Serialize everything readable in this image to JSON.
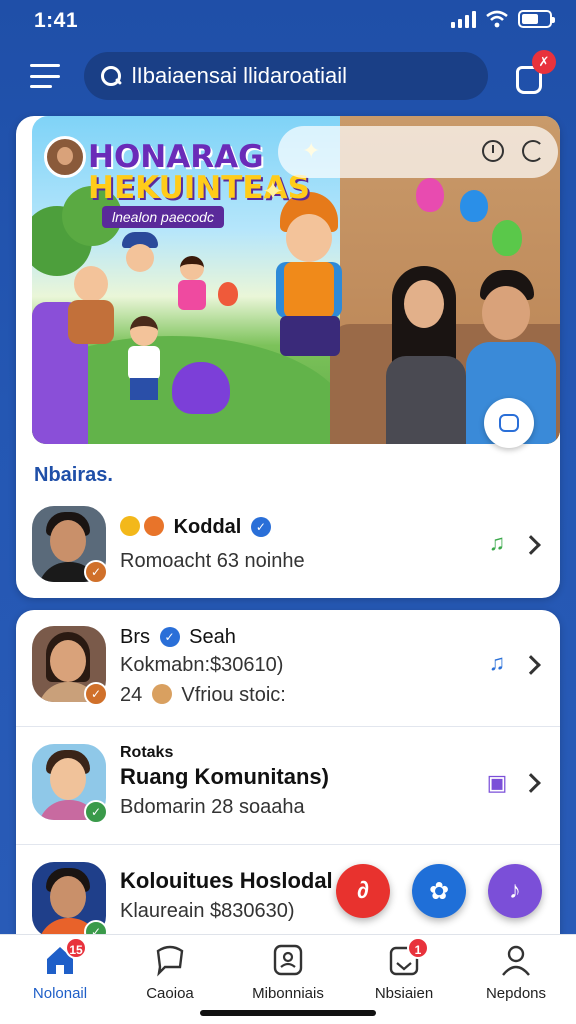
{
  "status_bar": {
    "time": "1:41"
  },
  "search": {
    "placeholder": "lIbaiaensai llidaroatiail"
  },
  "header": {
    "notification_badge": "✗"
  },
  "banner": {
    "title_line1": "HONARAG",
    "title_line2": "HEKUINTEAS",
    "subtitle": "lnealon paecodc"
  },
  "section": {
    "title": "Nbairas."
  },
  "items": [
    {
      "name": "Koddal",
      "subtitle": "Romoacht 63 noinhe",
      "badge_color": "#d0702a",
      "action_icon": "music-note-icon",
      "verified": true
    },
    {
      "name_prefix": "Brs",
      "name": "Seah",
      "subtitle": "Kokmabn:$30610)",
      "extra": "24",
      "extra_text": "Vfriou stoic:",
      "badge_color": "#d0702a",
      "action_icon": "music-heart-icon",
      "verified": true
    },
    {
      "label": "Rotaks",
      "name": "Ruang Komunitans)",
      "subtitle": "Bdomarin 28 soaaha",
      "badge_color": "#3a9a4a",
      "action_icon": "photo-icon"
    },
    {
      "name": "Kolouitues Hoslodal",
      "subtitle": "Klaureain $830630)",
      "badge_color": "#3a9a4a"
    }
  ],
  "fabs": [
    {
      "name": "link-fab",
      "color": "#e8322e"
    },
    {
      "name": "share-fab",
      "color": "#1f6fd8"
    },
    {
      "name": "audio-fab",
      "color": "#7b4fd8"
    }
  ],
  "bottom_nav": [
    {
      "label": "Nolonail",
      "icon": "home-icon",
      "badge": "15",
      "active": true
    },
    {
      "label": "Caoioa",
      "icon": "chat-icon"
    },
    {
      "label": "Mibonniais",
      "icon": "community-icon"
    },
    {
      "label": "Nbsiaien",
      "icon": "inbox-icon",
      "badge": "1"
    },
    {
      "label": "Nepdons",
      "icon": "profile-icon"
    }
  ]
}
